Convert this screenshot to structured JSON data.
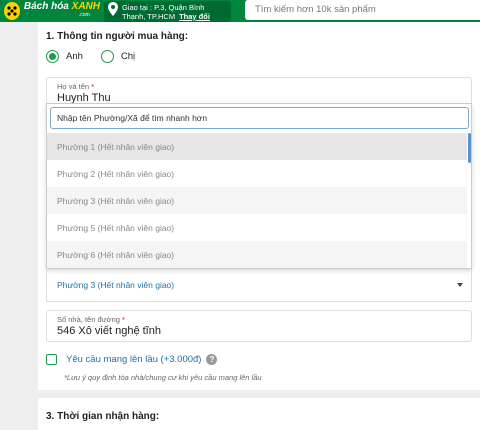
{
  "header": {
    "logo_text_black": "Bách hóa",
    "logo_text_green": "XANH",
    "logo_sub": ".com",
    "location_line1": "Giao tại : P.3, Quận Bình",
    "location_line2": "Thạnh, TP.HCM",
    "location_change": "Thay đổi",
    "search_placeholder": "Tìm kiếm hơn 10k sản phẩm"
  },
  "buyer": {
    "section_title": "1. Thông tin người mua hàng:",
    "gender_options": [
      "Anh",
      "Chị"
    ],
    "gender_selected": "Anh",
    "name_label": "Họ và tên",
    "name_value": "Huynh Thu",
    "required_mark": "*"
  },
  "dropdown": {
    "search_placeholder": "Nhập tên Phường/Xã để tìm nhanh hơn",
    "items": [
      "Phường 1 (Hết nhân viên giao)",
      "Phường 2 (Hết nhân viên giao)",
      "Phường 3 (Hết nhân viên giao)",
      "Phường 5 (Hết nhân viên giao)",
      "Phường 6 (Hết nhân viên giao)"
    ]
  },
  "ward_select": {
    "value": "Phường 3 (Hết nhân viên giao)"
  },
  "address": {
    "label": "Số nhà, tên đường",
    "value": "546 Xô viết nghệ tĩnh"
  },
  "upstairs": {
    "label": "Yêu cầu mang lên lầu (+3.000đ)",
    "help": "?",
    "note": "*Lưu ý quy định tòa nhà/chung cư khi yêu cầu mang lên lầu"
  },
  "time": {
    "section_title": "3. Thời gian nhận hàng:"
  },
  "colors": {
    "brand_green": "#00853f",
    "accent_blue": "#1a73a8"
  }
}
